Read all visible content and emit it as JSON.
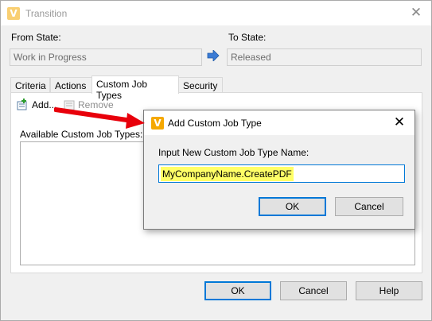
{
  "window": {
    "title": "Transition"
  },
  "from_state": {
    "label": "From State:",
    "value": "Work in Progress"
  },
  "to_state": {
    "label": "To State:",
    "value": "Released"
  },
  "tabs": [
    {
      "label": "Criteria"
    },
    {
      "label": "Actions"
    },
    {
      "label": "Custom Job Types",
      "active": true
    },
    {
      "label": "Security"
    }
  ],
  "toolbar": {
    "add_label": "Add...",
    "remove_label": "Remove"
  },
  "available_label": "Available Custom Job Types:",
  "footer": {
    "ok": "OK",
    "cancel": "Cancel",
    "help": "Help"
  },
  "dialog": {
    "title": "Add Custom Job Type",
    "prompt": "Input New Custom Job Type Name:",
    "input_value": "MyCompanyName.CreatePDF",
    "ok": "OK",
    "cancel": "Cancel"
  },
  "colors": {
    "accent": "#0078d7",
    "highlight": "#ffff66",
    "annotation": "#e8000b",
    "brand": "#f5a800"
  },
  "icons": {
    "app": "vault-logo-icon",
    "arrow": "right-arrow-icon",
    "add": "add-icon",
    "remove": "remove-icon"
  }
}
